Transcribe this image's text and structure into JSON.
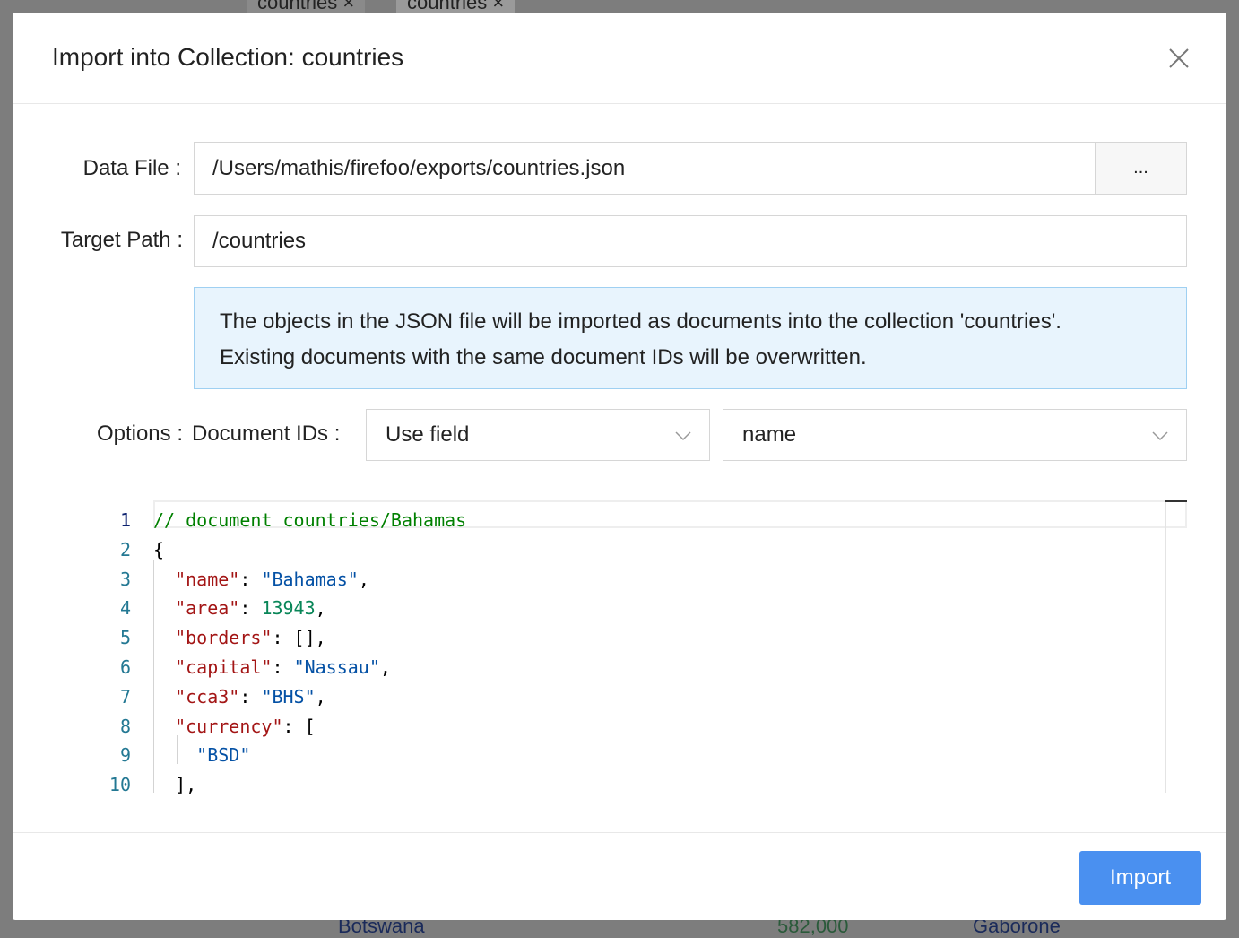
{
  "background": {
    "tabs": [
      "countries ×",
      "countries ×"
    ],
    "row": {
      "name": "Botswana",
      "area": "582,000",
      "capital": "Gaborone"
    }
  },
  "dialog": {
    "title": "Import into Collection: countries",
    "data_file_label": "Data File",
    "data_file_value": "/Users/mathis/firefoo/exports/countries.json",
    "browse_label": "...",
    "target_path_label": "Target Path",
    "target_path_value": "/countries",
    "info_line1": "The objects in the JSON file will be imported as documents into the collection 'countries'.",
    "info_line2": "Existing documents with the same document IDs will be overwritten.",
    "options_label": "Options",
    "document_ids_label": "Document IDs",
    "document_ids_mode": "Use field",
    "document_ids_field": "name",
    "import_label": "Import",
    "accent_color": "#4a90f0"
  },
  "preview": {
    "lines": [
      {
        "num": "1",
        "tokens": [
          {
            "t": "// document countries/Bahamas",
            "c": "c"
          }
        ]
      },
      {
        "num": "2",
        "tokens": [
          {
            "t": "{",
            "c": ""
          }
        ]
      },
      {
        "num": "3",
        "tokens": [
          {
            "t": "  ",
            "c": ""
          },
          {
            "t": "\"name\"",
            "c": "k"
          },
          {
            "t": ": ",
            "c": ""
          },
          {
            "t": "\"Bahamas\"",
            "c": "s"
          },
          {
            "t": ",",
            "c": ""
          }
        ]
      },
      {
        "num": "4",
        "tokens": [
          {
            "t": "  ",
            "c": ""
          },
          {
            "t": "\"area\"",
            "c": "k"
          },
          {
            "t": ": ",
            "c": ""
          },
          {
            "t": "13943",
            "c": "n"
          },
          {
            "t": ",",
            "c": ""
          }
        ]
      },
      {
        "num": "5",
        "tokens": [
          {
            "t": "  ",
            "c": ""
          },
          {
            "t": "\"borders\"",
            "c": "k"
          },
          {
            "t": ": [],",
            "c": ""
          }
        ]
      },
      {
        "num": "6",
        "tokens": [
          {
            "t": "  ",
            "c": ""
          },
          {
            "t": "\"capital\"",
            "c": "k"
          },
          {
            "t": ": ",
            "c": ""
          },
          {
            "t": "\"Nassau\"",
            "c": "s"
          },
          {
            "t": ",",
            "c": ""
          }
        ]
      },
      {
        "num": "7",
        "tokens": [
          {
            "t": "  ",
            "c": ""
          },
          {
            "t": "\"cca3\"",
            "c": "k"
          },
          {
            "t": ": ",
            "c": ""
          },
          {
            "t": "\"BHS\"",
            "c": "s"
          },
          {
            "t": ",",
            "c": ""
          }
        ]
      },
      {
        "num": "8",
        "tokens": [
          {
            "t": "  ",
            "c": ""
          },
          {
            "t": "\"currency\"",
            "c": "k"
          },
          {
            "t": ": [",
            "c": ""
          }
        ]
      },
      {
        "num": "9",
        "tokens": [
          {
            "t": "    ",
            "c": ""
          },
          {
            "t": "\"BSD\"",
            "c": "s"
          }
        ]
      },
      {
        "num": "10",
        "tokens": [
          {
            "t": "  ],",
            "c": ""
          }
        ]
      }
    ]
  }
}
